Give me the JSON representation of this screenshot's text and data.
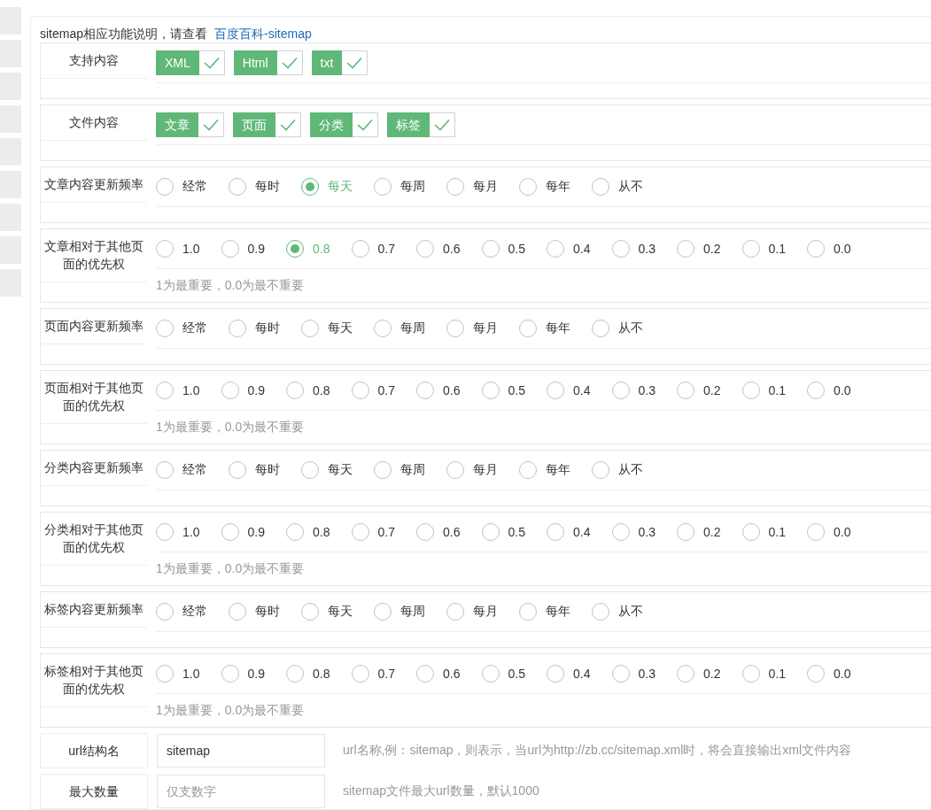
{
  "intro": {
    "text": "sitemap相应功能说明，请查看",
    "link": "百度百科-sitemap"
  },
  "sections": [
    {
      "kind": "checkgroup",
      "label": "支持内容",
      "options": [
        {
          "label": "XML",
          "checked": true
        },
        {
          "label": "Html",
          "checked": true
        },
        {
          "label": "txt",
          "checked": true
        }
      ]
    },
    {
      "kind": "checkgroup",
      "label": "文件内容",
      "options": [
        {
          "label": "文章",
          "checked": true
        },
        {
          "label": "页面",
          "checked": true
        },
        {
          "label": "分类",
          "checked": true
        },
        {
          "label": "标签",
          "checked": true
        }
      ]
    },
    {
      "kind": "frequency",
      "label": "文章内容更新频率",
      "options": [
        {
          "label": "经常",
          "selected": false
        },
        {
          "label": "每时",
          "selected": false
        },
        {
          "label": "每天",
          "selected": true
        },
        {
          "label": "每周",
          "selected": false
        },
        {
          "label": "每月",
          "selected": false
        },
        {
          "label": "每年",
          "selected": false
        },
        {
          "label": "从不",
          "selected": false
        }
      ]
    },
    {
      "kind": "priority",
      "label": "文章相对于其他页面的优先权",
      "hint": "1为最重要，0.0为最不重要",
      "options": [
        {
          "label": "1.0",
          "selected": false
        },
        {
          "label": "0.9",
          "selected": false
        },
        {
          "label": "0.8",
          "selected": true
        },
        {
          "label": "0.7",
          "selected": false
        },
        {
          "label": "0.6",
          "selected": false
        },
        {
          "label": "0.5",
          "selected": false
        },
        {
          "label": "0.4",
          "selected": false
        },
        {
          "label": "0.3",
          "selected": false
        },
        {
          "label": "0.2",
          "selected": false
        },
        {
          "label": "0.1",
          "selected": false
        },
        {
          "label": "0.0",
          "selected": false
        }
      ]
    },
    {
      "kind": "frequency",
      "label": "页面内容更新频率",
      "options": [
        {
          "label": "经常",
          "selected": false
        },
        {
          "label": "每时",
          "selected": false
        },
        {
          "label": "每天",
          "selected": false
        },
        {
          "label": "每周",
          "selected": false
        },
        {
          "label": "每月",
          "selected": false
        },
        {
          "label": "每年",
          "selected": false
        },
        {
          "label": "从不",
          "selected": false
        }
      ]
    },
    {
      "kind": "priority",
      "label": "页面相对于其他页面的优先权",
      "hint": "1为最重要，0.0为最不重要",
      "options": [
        {
          "label": "1.0",
          "selected": false
        },
        {
          "label": "0.9",
          "selected": false
        },
        {
          "label": "0.8",
          "selected": false
        },
        {
          "label": "0.7",
          "selected": false
        },
        {
          "label": "0.6",
          "selected": false
        },
        {
          "label": "0.5",
          "selected": false
        },
        {
          "label": "0.4",
          "selected": false
        },
        {
          "label": "0.3",
          "selected": false
        },
        {
          "label": "0.2",
          "selected": false
        },
        {
          "label": "0.1",
          "selected": false
        },
        {
          "label": "0.0",
          "selected": false
        }
      ]
    },
    {
      "kind": "frequency",
      "label": "分类内容更新频率",
      "options": [
        {
          "label": "经常",
          "selected": false
        },
        {
          "label": "每时",
          "selected": false
        },
        {
          "label": "每天",
          "selected": false
        },
        {
          "label": "每周",
          "selected": false
        },
        {
          "label": "每月",
          "selected": false
        },
        {
          "label": "每年",
          "selected": false
        },
        {
          "label": "从不",
          "selected": false
        }
      ]
    },
    {
      "kind": "priority",
      "label": "分类相对于其他页面的优先权",
      "hint": "1为最重要，0.0为最不重要",
      "options": [
        {
          "label": "1.0",
          "selected": false
        },
        {
          "label": "0.9",
          "selected": false
        },
        {
          "label": "0.8",
          "selected": false
        },
        {
          "label": "0.7",
          "selected": false
        },
        {
          "label": "0.6",
          "selected": false
        },
        {
          "label": "0.5",
          "selected": false
        },
        {
          "label": "0.4",
          "selected": false
        },
        {
          "label": "0.3",
          "selected": false
        },
        {
          "label": "0.2",
          "selected": false
        },
        {
          "label": "0.1",
          "selected": false
        },
        {
          "label": "0.0",
          "selected": false
        }
      ]
    },
    {
      "kind": "frequency",
      "label": "标签内容更新频率",
      "options": [
        {
          "label": "经常",
          "selected": false
        },
        {
          "label": "每时",
          "selected": false
        },
        {
          "label": "每天",
          "selected": false
        },
        {
          "label": "每周",
          "selected": false
        },
        {
          "label": "每月",
          "selected": false
        },
        {
          "label": "每年",
          "selected": false
        },
        {
          "label": "从不",
          "selected": false
        }
      ]
    },
    {
      "kind": "priority",
      "label": "标签相对于其他页面的优先权",
      "hint": "1为最重要，0.0为最不重要",
      "options": [
        {
          "label": "1.0",
          "selected": false
        },
        {
          "label": "0.9",
          "selected": false
        },
        {
          "label": "0.8",
          "selected": false
        },
        {
          "label": "0.7",
          "selected": false
        },
        {
          "label": "0.6",
          "selected": false
        },
        {
          "label": "0.5",
          "selected": false
        },
        {
          "label": "0.4",
          "selected": false
        },
        {
          "label": "0.3",
          "selected": false
        },
        {
          "label": "0.2",
          "selected": false
        },
        {
          "label": "0.1",
          "selected": false
        },
        {
          "label": "0.0",
          "selected": false
        }
      ]
    },
    {
      "kind": "text",
      "label": "url结构名",
      "value": "sitemap",
      "hint": "url名称,例：sitemap，则表示，当url为http://zb.cc/sitemap.xml时，将会直接输出xml文件内容"
    },
    {
      "kind": "text",
      "label": "最大数量",
      "placeholder": "仅支数字",
      "hint": "sitemap文件最大url数量，默认1000"
    }
  ]
}
